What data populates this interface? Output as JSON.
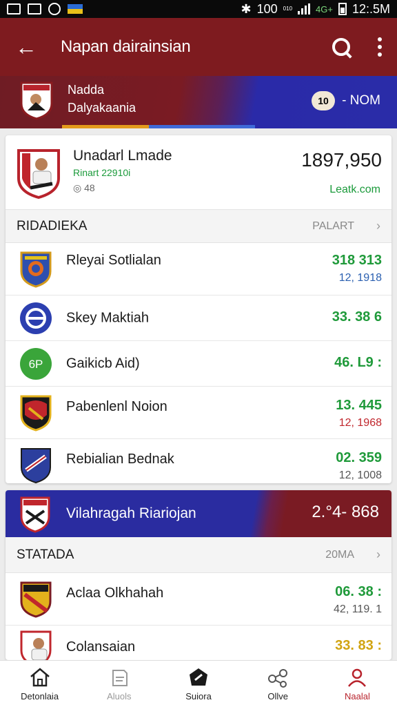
{
  "status_bar": {
    "battery_text": "12:.5M",
    "indicator": "100",
    "network": "4G+",
    "tiny": "010"
  },
  "app_bar": {
    "title": "Napan dairainsian",
    "back_icon": "arrow-left-icon",
    "search_icon": "search-icon",
    "more_icon": "more-vert-icon"
  },
  "banner": {
    "name1": "Nadda",
    "name2": "Dalyakaania",
    "chip_label": "- NOM",
    "chip_icon": "10"
  },
  "hero": {
    "name": "Unadarl Lmade",
    "sub": "Rinart 22910i",
    "meta": "◎ 48",
    "value": "1897,950",
    "link": "Leatk.com"
  },
  "section1": {
    "title": "RIDADIEKA",
    "action": "PALART"
  },
  "rows1": [
    {
      "name": "Rleyai Sotlialan",
      "v1": "318 313",
      "v1_color": "#1f9a3a",
      "v2": "12, 1918",
      "v2_color": "#2a5fb0"
    },
    {
      "name": "Skey Maktiah",
      "v1": "33. 38 6",
      "v1_color": "#1f9a3a"
    },
    {
      "name": "Gaikicb Aid)",
      "v1": "46. L9 :",
      "v1_color": "#1f9a3a",
      "v1b_color": "#c0262c",
      "crest_text": "6P"
    },
    {
      "name": "Pabenlenl Noion",
      "v1": "13. 445",
      "v1_color": "#1f9a3a",
      "v2": "12, 1968",
      "v2_color": "#c0262c"
    },
    {
      "name": "Rebialian Bednak",
      "v1": "02. 359",
      "v1_color": "#1f9a3a",
      "v2": "12, 1008"
    }
  ],
  "blue_banner": {
    "title": "Vilahragah Riariojan",
    "score": "2.°4- 868"
  },
  "section2": {
    "title": "STATADA",
    "action": "20MA"
  },
  "rows2": [
    {
      "name": "Aclaa Olkhahah",
      "v1": "06. 38 :",
      "v1_color": "#1f9a3a",
      "v2": "42, 119. 1"
    },
    {
      "name": "Colansaian",
      "v1": "33. 83 :",
      "v1_color": "#d1a412"
    }
  ],
  "bottom_nav": [
    {
      "label": "Detonlaia",
      "icon": "home-icon"
    },
    {
      "label": "Aluols",
      "icon": "document-icon"
    },
    {
      "label": "Suiora",
      "icon": "scoreboard-icon"
    },
    {
      "label": "Ollve",
      "icon": "share-icon"
    },
    {
      "label": "Naalal",
      "icon": "profile-icon"
    }
  ]
}
